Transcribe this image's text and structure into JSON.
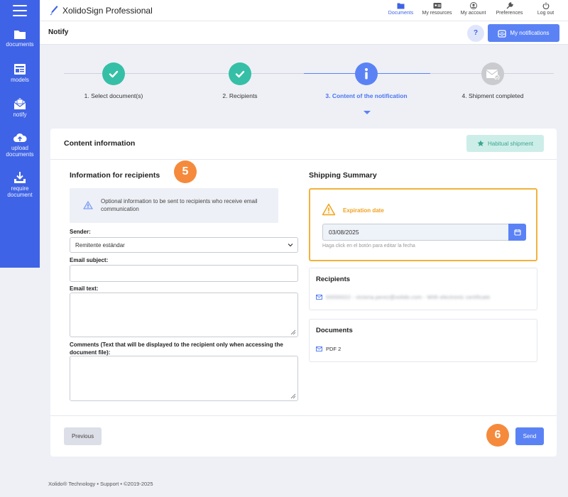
{
  "app": {
    "brand": "XolidoSign Professional"
  },
  "sidebar": {
    "items": [
      {
        "label": "documents",
        "icon": "folder-icon"
      },
      {
        "label": "models",
        "icon": "models-icon"
      },
      {
        "label": "notify",
        "icon": "notify-icon"
      },
      {
        "label": "upload documents",
        "icon": "upload-cloud-icon"
      },
      {
        "label": "require document",
        "icon": "download-tray-icon"
      }
    ]
  },
  "topnav": [
    {
      "label": "Documents",
      "icon": "folder-icon",
      "active": true
    },
    {
      "label": "My resources",
      "icon": "id-card-icon",
      "active": false
    },
    {
      "label": "My account",
      "icon": "user-icon",
      "active": false
    },
    {
      "label": "Preferences",
      "icon": "wrench-icon",
      "active": false
    },
    {
      "label": "Log out",
      "icon": "power-icon",
      "active": false
    }
  ],
  "subheader": {
    "title": "Notify",
    "help": "?",
    "notifications": "My notifications"
  },
  "stepper": {
    "steps": [
      {
        "label": "1. Select document(s)",
        "state": "done"
      },
      {
        "label": "2. Recipients",
        "state": "done"
      },
      {
        "label": "3. Content of the notification",
        "state": "current"
      },
      {
        "label": "4. Shipment completed",
        "state": "pending"
      }
    ]
  },
  "card": {
    "title": "Content information",
    "habitual_shipment": "Habitual shipment",
    "left": {
      "title": "Information for recipients",
      "badge": "5",
      "info": "Optional information to be sent to recipients who receive email communication",
      "sender_label": "Sender:",
      "sender_value": "Remitente estándar",
      "subject_label": "Email subject:",
      "subject_value": "",
      "text_label": "Email text:",
      "text_value": "",
      "comments_label": "Comments (Text that will be displayed to the recipient only when accessing the document file):",
      "comments_value": ""
    },
    "right": {
      "title": "Shipping Summary",
      "expiration_title": "Expiration date",
      "expiration_value": "03/08/2025",
      "expiration_hint": "Haga click en el botón para editar la fecha",
      "recipients_title": "Recipients",
      "recipient_row": "00000022 - victoria.perez@xolido.com - With electronic certificate",
      "documents_title": "Documents",
      "document_row": "PDF 2"
    },
    "previous": "Previous",
    "send": "Send",
    "badge_send": "6"
  },
  "footer": {
    "text": "Xolido® Technology • Support • ©2019-2025"
  }
}
